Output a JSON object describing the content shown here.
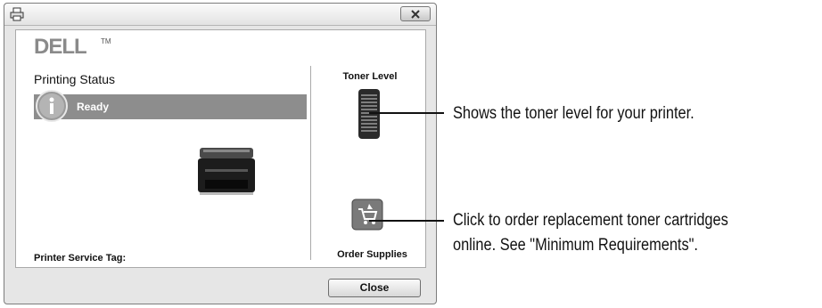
{
  "window": {
    "title_icon": "printer-icon",
    "close_icon": "close-icon",
    "logo": "DELL",
    "logo_tm": "TM"
  },
  "status": {
    "title": "Printing Status",
    "icon": "info-icon",
    "value": "Ready",
    "bar_color": "#8d8d8d"
  },
  "toner": {
    "label": "Toner Level",
    "icon": "toner-gauge-icon"
  },
  "order": {
    "label": "Order Supplies",
    "icon": "order-supplies-icon",
    "icon_color": "#7a7a7a"
  },
  "service_tag": {
    "label": "Printer Service Tag:"
  },
  "buttons": {
    "close": "Close"
  },
  "callouts": {
    "toner": "Shows the toner level for your printer.",
    "order_line1": "Click to order replacement toner cartridges",
    "order_line2": "online. See \"Minimum Requirements\"."
  }
}
